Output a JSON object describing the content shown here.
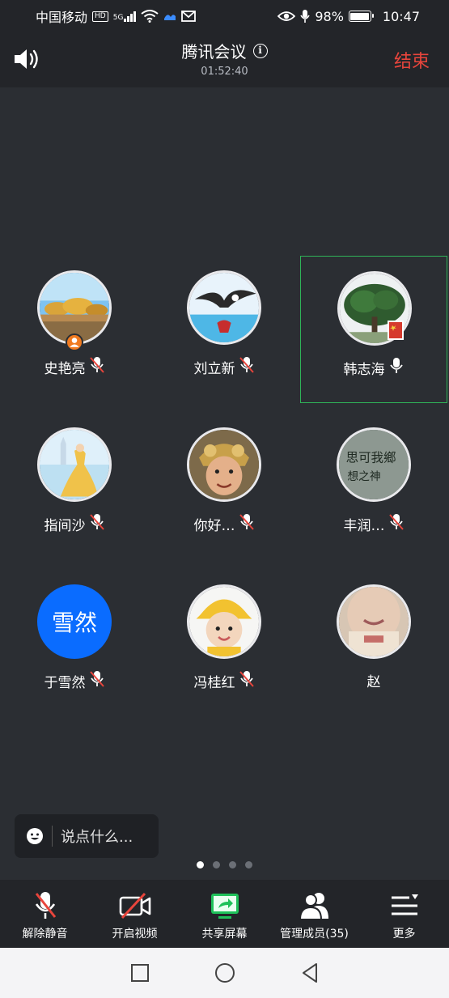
{
  "status_bar": {
    "carrier": "中国移动",
    "hd": "HD",
    "network": "5G",
    "battery": "98%",
    "battery_level": 0.98,
    "time": "10:47"
  },
  "header": {
    "title": "腾讯会议",
    "timer": "01:52:40",
    "end_label": "结束"
  },
  "participants": [
    {
      "name": "史艳亮",
      "muted": true,
      "avatar": "desert-trees"
    },
    {
      "name": "刘立新",
      "muted": true,
      "avatar": "eagle"
    },
    {
      "name": "韩志海",
      "muted": false,
      "avatar": "big-tree",
      "speaking": true
    },
    {
      "name": "指间沙",
      "muted": true,
      "avatar": "princess"
    },
    {
      "name": "你好…",
      "muted": true,
      "avatar": "monkey-king"
    },
    {
      "name": "丰润…",
      "muted": true,
      "avatar": "calligraphy-stone"
    },
    {
      "name": "于雪然",
      "muted": true,
      "avatar_text": "雪然"
    },
    {
      "name": "冯桂红",
      "muted": true,
      "avatar": "baby-yellow-hat"
    },
    {
      "name": "赵",
      "muted": null,
      "avatar": "face-mask"
    }
  ],
  "chat": {
    "placeholder": "说点什么..."
  },
  "toolbar": {
    "unmute": "解除静音",
    "video": "开启视频",
    "share": "共享屏幕",
    "members": "管理成员(35)",
    "more": "更多"
  },
  "colors": {
    "end": "#e8453c",
    "active_border": "#2fb358",
    "share_green": "#1fc15a",
    "text_avatar_bg": "#0a6cff"
  }
}
